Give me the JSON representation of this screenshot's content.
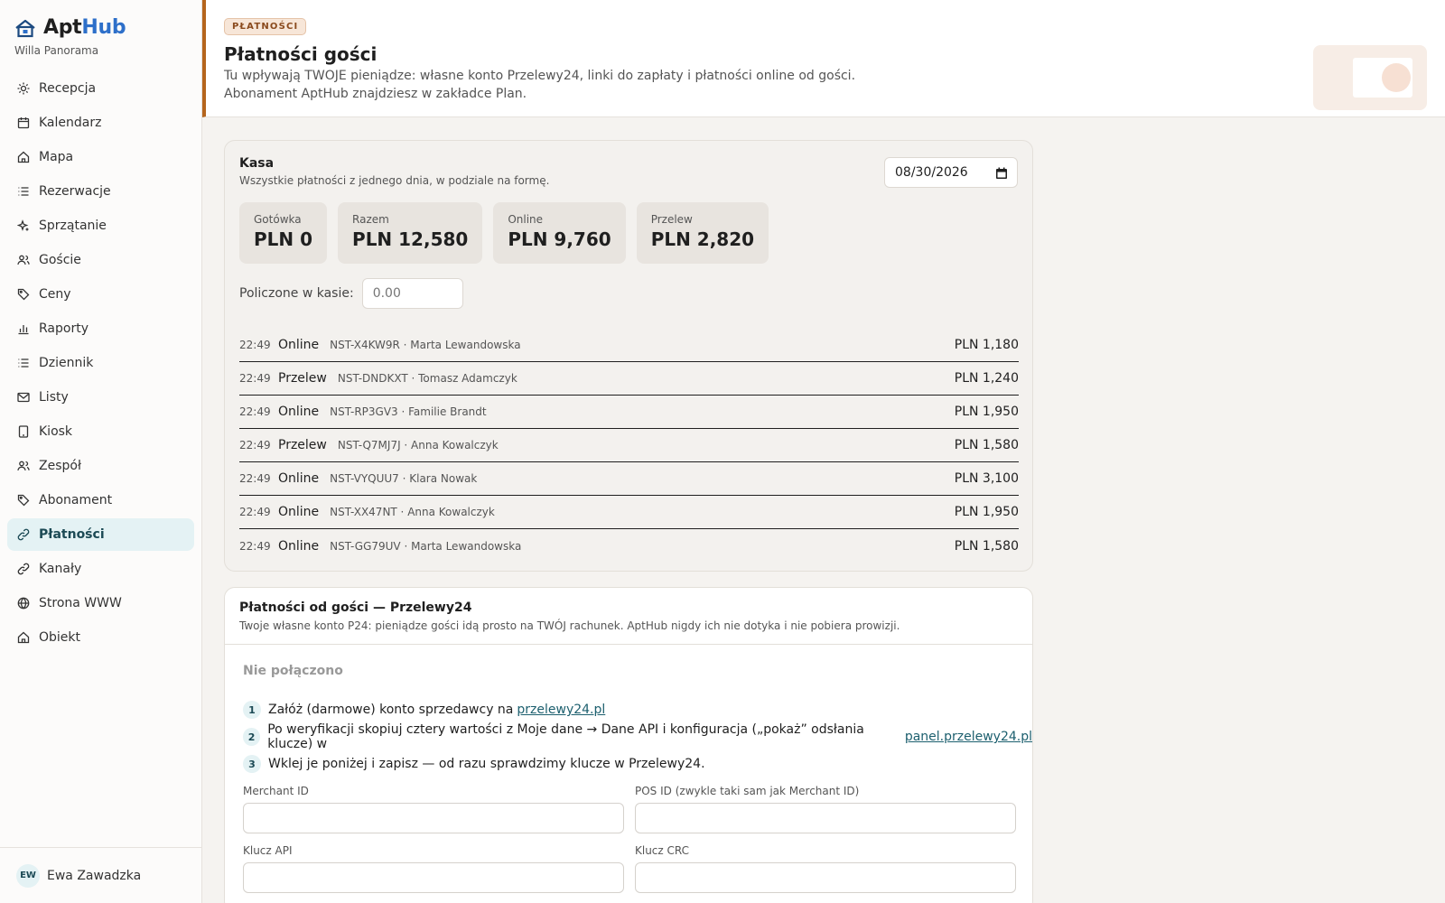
{
  "brand": {
    "name_a": "Apt",
    "name_b": "Hub",
    "property": "Willa Panorama"
  },
  "nav": [
    {
      "label": "Recepcja",
      "icon": "sun-icon"
    },
    {
      "label": "Kalendarz",
      "icon": "calendar-icon"
    },
    {
      "label": "Mapa",
      "icon": "home-icon"
    },
    {
      "label": "Rezerwacje",
      "icon": "list-icon"
    },
    {
      "label": "Sprzątanie",
      "icon": "sparkle-icon"
    },
    {
      "label": "Goście",
      "icon": "users-icon"
    },
    {
      "label": "Ceny",
      "icon": "tag-icon"
    },
    {
      "label": "Raporty",
      "icon": "bar-chart-icon"
    },
    {
      "label": "Dziennik",
      "icon": "list-icon"
    },
    {
      "label": "Listy",
      "icon": "mail-icon"
    },
    {
      "label": "Kiosk",
      "icon": "tablet-icon"
    },
    {
      "label": "Zespół",
      "icon": "users-icon"
    },
    {
      "label": "Abonament",
      "icon": "tag-icon"
    },
    {
      "label": "Płatności",
      "icon": "link-icon",
      "active": true
    },
    {
      "label": "Kanały",
      "icon": "link-icon"
    },
    {
      "label": "Strona WWW",
      "icon": "globe-icon"
    },
    {
      "label": "Obiekt",
      "icon": "home-icon"
    }
  ],
  "user": {
    "initials": "EW",
    "name": "Ewa Zawadzka"
  },
  "header": {
    "badge": "PŁATNOŚCI",
    "title": "Płatności gości",
    "desc_line1": "Tu wpływają TWOJE pieniądze: własne konto Przelewy24, linki do zapłaty i płatności online od gości.",
    "desc_line2": "Abonament AptHub znajdziesz w zakładce Plan."
  },
  "kasa": {
    "title": "Kasa",
    "subtitle": "Wszystkie płatności z jednego dnia, w podziale na formę.",
    "date": "08/30/2026",
    "stats": [
      {
        "label": "Gotówka",
        "value": "PLN 0"
      },
      {
        "label": "Razem",
        "value": "PLN 12,580"
      },
      {
        "label": "Online",
        "value": "PLN 9,760"
      },
      {
        "label": "Przelew",
        "value": "PLN 2,820"
      }
    ],
    "counted_label": "Policzone w kasie:",
    "counted_placeholder": "0.00",
    "rows": [
      {
        "time": "22:49",
        "method": "Online",
        "ref": "NST-X4KW9R · Marta Lewandowska",
        "amount": "PLN 1,180"
      },
      {
        "time": "22:49",
        "method": "Przelew",
        "ref": "NST-DNDKXT · Tomasz Adamczyk",
        "amount": "PLN 1,240"
      },
      {
        "time": "22:49",
        "method": "Online",
        "ref": "NST-RP3GV3 · Familie Brandt",
        "amount": "PLN 1,950"
      },
      {
        "time": "22:49",
        "method": "Przelew",
        "ref": "NST-Q7MJ7J · Anna Kowalczyk",
        "amount": "PLN 1,580"
      },
      {
        "time": "22:49",
        "method": "Online",
        "ref": "NST-VYQUU7 · Klara Nowak",
        "amount": "PLN 3,100"
      },
      {
        "time": "22:49",
        "method": "Online",
        "ref": "NST-XX47NT · Anna Kowalczyk",
        "amount": "PLN 1,950"
      },
      {
        "time": "22:49",
        "method": "Online",
        "ref": "NST-GG79UV · Marta Lewandowska",
        "amount": "PLN 1,580"
      }
    ]
  },
  "p24": {
    "title": "Płatności od gości — Przelewy24",
    "subtitle": "Twoje własne konto P24: pieniądze gości idą prosto na TWÓJ rachunek. AptHub nigdy ich nie dotyka i nie pobiera prowizji.",
    "status": "Nie połączono",
    "steps": [
      {
        "num": "1",
        "text": "Załóż (darmowe) konto sprzedawcy na",
        "link": "przelewy24.pl"
      },
      {
        "num": "2",
        "text": "Po weryfikacji skopiuj cztery wartości z Moje dane → Dane API i konfiguracja („pokaż” odsłania klucze) w",
        "link": "panel.przelewy24.pl"
      },
      {
        "num": "3",
        "text": "Wklej je poniżej i zapisz — od razu sprawdzimy klucze w Przelewy24.",
        "link": ""
      }
    ],
    "fields": {
      "merchant_id": "Merchant ID",
      "pos_id": "POS ID (zwykle taki sam jak Merchant ID)",
      "api_key": "Klucz API",
      "crc_key": "Klucz CRC"
    }
  },
  "colors": {
    "accent": "#b5651d",
    "active_bg": "#e4f2f4",
    "brand_blue": "#2d6fc9",
    "link": "#1c5f6e"
  }
}
